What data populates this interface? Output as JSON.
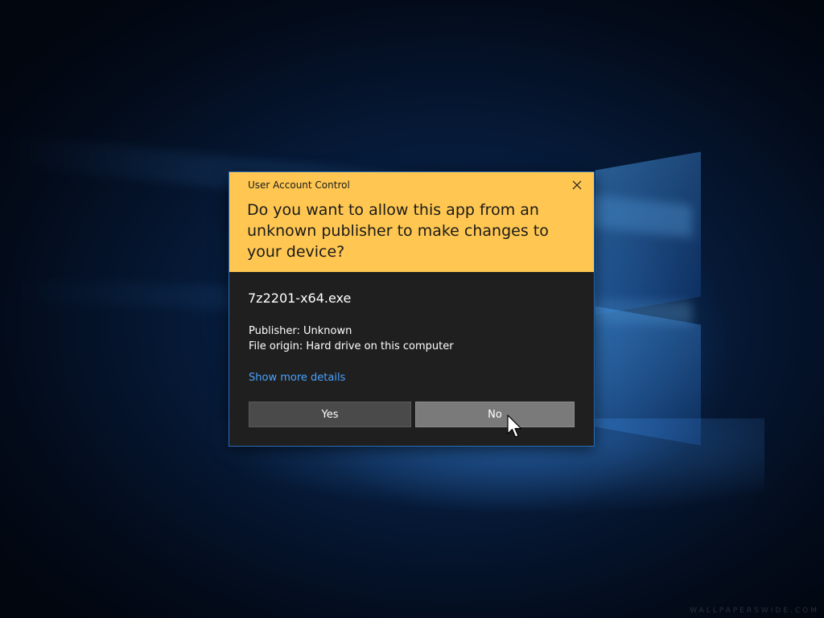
{
  "dialog": {
    "title": "User Account Control",
    "question": "Do you want to allow this app from an unknown publisher to make changes to your device?",
    "app_name": "7z2201-x64.exe",
    "publisher": "Publisher: Unknown",
    "file_origin": "File origin: Hard drive on this computer",
    "more_details_link": "Show more details",
    "yes_label": "Yes",
    "no_label": "No",
    "close_icon": "close-icon",
    "header_color": "#ffc751",
    "body_color": "#1f1f1f",
    "link_color": "#4aa3ff"
  },
  "desktop": {
    "watermark": "WALLPAPERSWIDE.COM",
    "cursor_icon": "mouse-pointer-icon"
  }
}
